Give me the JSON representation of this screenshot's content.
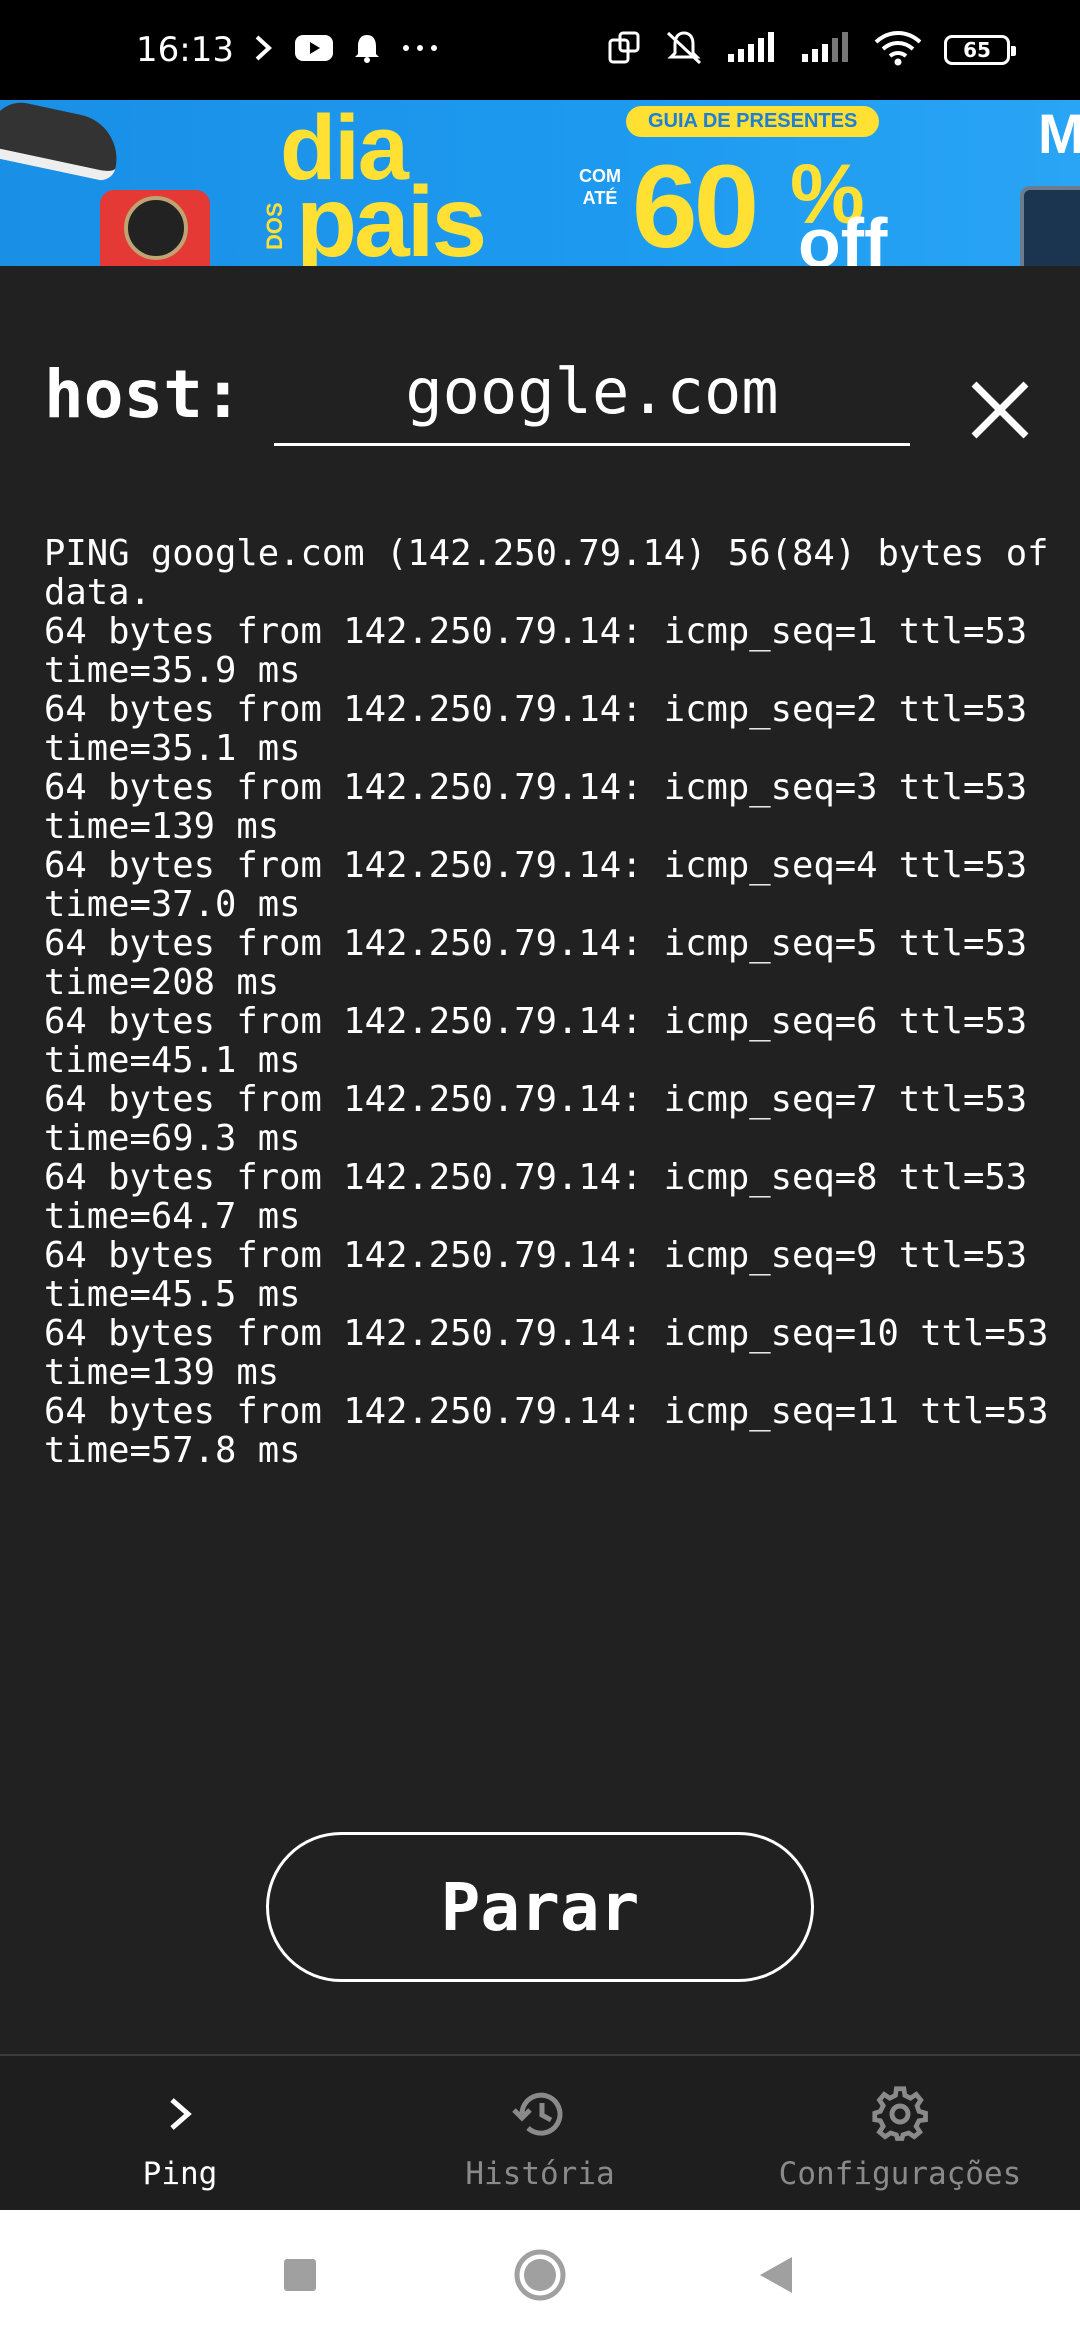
{
  "status_bar": {
    "time": "16:13",
    "battery": "65",
    "left_icons": [
      "chevron-right-icon",
      "youtube-icon",
      "bell-icon",
      "more-icon"
    ],
    "right_icons": [
      "screen-rotate-icon",
      "vibrate-off-icon",
      "signal-icon",
      "signal-icon",
      "wifi-icon",
      "battery-icon"
    ]
  },
  "ad": {
    "dia": "dia",
    "dos": "DOS",
    "pais": "pais",
    "com_ate": "COM ATÉ",
    "guia": "GUIA DE PRESENTES",
    "percent_value": "60",
    "percent_sign": "%",
    "off": "off",
    "brand_letter": "M"
  },
  "host": {
    "label": "host:",
    "value": "google.com"
  },
  "output": [
    "PING google.com (142.250.79.14) 56(84) bytes of data.",
    "64 bytes from 142.250.79.14: icmp_seq=1 ttl=53 time=35.9 ms",
    "64 bytes from 142.250.79.14: icmp_seq=2 ttl=53 time=35.1 ms",
    "64 bytes from 142.250.79.14: icmp_seq=3 ttl=53 time=139 ms",
    "64 bytes from 142.250.79.14: icmp_seq=4 ttl=53 time=37.0 ms",
    "64 bytes from 142.250.79.14: icmp_seq=5 ttl=53 time=208 ms",
    "64 bytes from 142.250.79.14: icmp_seq=6 ttl=53 time=45.1 ms",
    "64 bytes from 142.250.79.14: icmp_seq=7 ttl=53 time=69.3 ms",
    "64 bytes from 142.250.79.14: icmp_seq=8 ttl=53 time=64.7 ms",
    "64 bytes from 142.250.79.14: icmp_seq=9 ttl=53 time=45.5 ms",
    "64 bytes from 142.250.79.14: icmp_seq=10 ttl=53 time=139 ms",
    "64 bytes from 142.250.79.14: icmp_seq=11 ttl=53 time=57.8 ms"
  ],
  "stop_button": {
    "label": "Parar"
  },
  "nav": {
    "items": [
      {
        "label": "Ping",
        "icon": "chevron-right-icon",
        "active": true
      },
      {
        "label": "História",
        "icon": "history-icon",
        "active": false
      },
      {
        "label": "Configurações",
        "icon": "gear-icon",
        "active": false
      }
    ]
  },
  "system_nav": {
    "icons": [
      "recents-square-icon",
      "home-circle-icon",
      "back-triangle-icon"
    ]
  },
  "colors": {
    "background": "#212121",
    "status_bar": "#000000",
    "ad_blue": "#1d9bf0",
    "ad_yellow": "#ffe033",
    "text": "#ffffff",
    "nav_inactive": "#8a8a8a",
    "system_nav_bg": "#ffffff"
  }
}
